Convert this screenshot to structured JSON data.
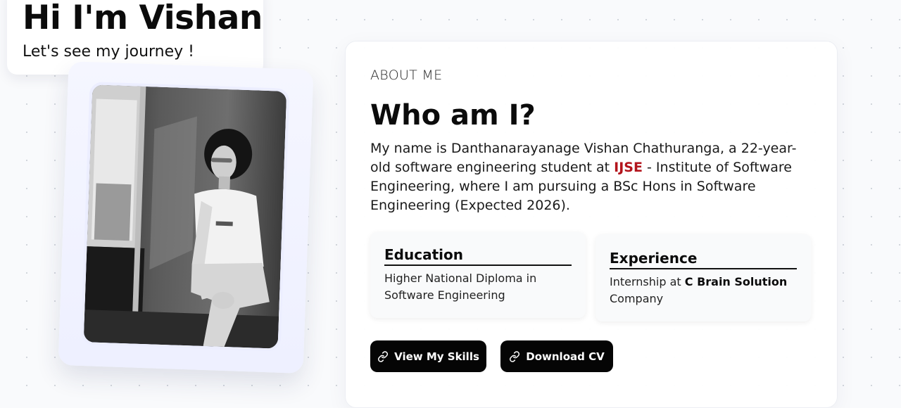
{
  "hero": {
    "title": "Hi I'm Vishan",
    "subtitle": "Let's see my journey !"
  },
  "profile": {
    "photo": "black-and-white portrait of a young man sitting by a window"
  },
  "about": {
    "eyebrow": "ABOUT ME",
    "title": "Who am I?",
    "bio_before": "My name is Danthanarayanage Vishan Chathuranga, a 22-year-old software engineering student at ",
    "bio_highlight": "IJSE",
    "bio_after": " - Institute of Software Engineering, where I am pursuing a BSc Hons in Software Engineering (Expected 2026).",
    "highlight_color": "#b3141c"
  },
  "education": {
    "title": "Education",
    "text": "Higher National Diploma in Software Engineering"
  },
  "experience": {
    "title": "Experience",
    "text_before": "Internship at ",
    "text_bold": "C Brain Solution",
    "text_after": " Company"
  },
  "buttons": {
    "skills_label": "View My Skills",
    "cv_label": "Download CV",
    "icon": "link-icon"
  }
}
